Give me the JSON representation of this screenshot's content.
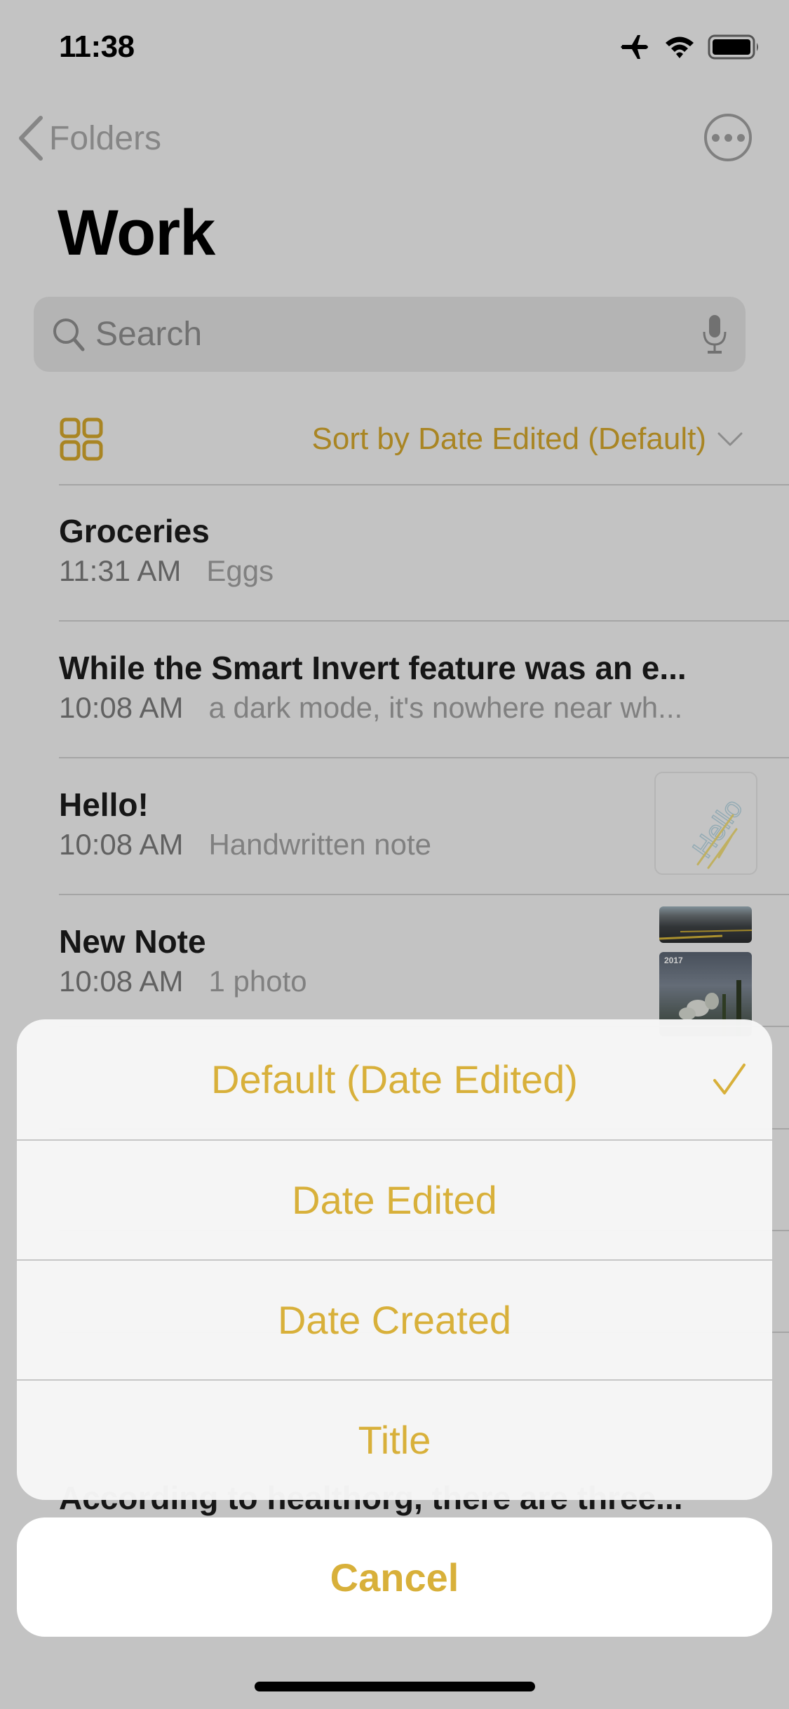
{
  "status_bar": {
    "time": "11:38",
    "icons": [
      "airplane-icon",
      "wifi-icon",
      "battery-icon"
    ]
  },
  "nav": {
    "back_label": "Folders",
    "more_icon": "ellipsis-circle-icon"
  },
  "page": {
    "title": "Work"
  },
  "search": {
    "placeholder": "Search",
    "value": ""
  },
  "toolbar": {
    "grid_icon": "gallery-view-icon",
    "sort_label": "Sort by Date Edited (Default)"
  },
  "notes": [
    {
      "title": "Groceries",
      "time": "11:31 AM",
      "preview": "Eggs"
    },
    {
      "title": "While the Smart Invert feature was an e...",
      "time": "10:08 AM",
      "preview": "a dark mode, it's nowhere near wh..."
    },
    {
      "title": "Hello!",
      "time": "10:08 AM",
      "preview": "Handwritten note",
      "thumbnail": "handwriting"
    },
    {
      "title": "New Note",
      "time": "10:08 AM",
      "preview": "1 photo",
      "thumbnail": "photo",
      "thumbnail_year": "2017"
    }
  ],
  "obscured_note_title": "According to healthorg, there are three...",
  "action_sheet": {
    "options": [
      {
        "label": "Default (Date Edited)",
        "selected": true
      },
      {
        "label": "Date Edited",
        "selected": false
      },
      {
        "label": "Date Created",
        "selected": false
      },
      {
        "label": "Title",
        "selected": false
      }
    ],
    "cancel_label": "Cancel"
  },
  "colors": {
    "accent": "#d8b03a",
    "background": "#f4f4f4",
    "sheet": "#f6f6f6"
  }
}
